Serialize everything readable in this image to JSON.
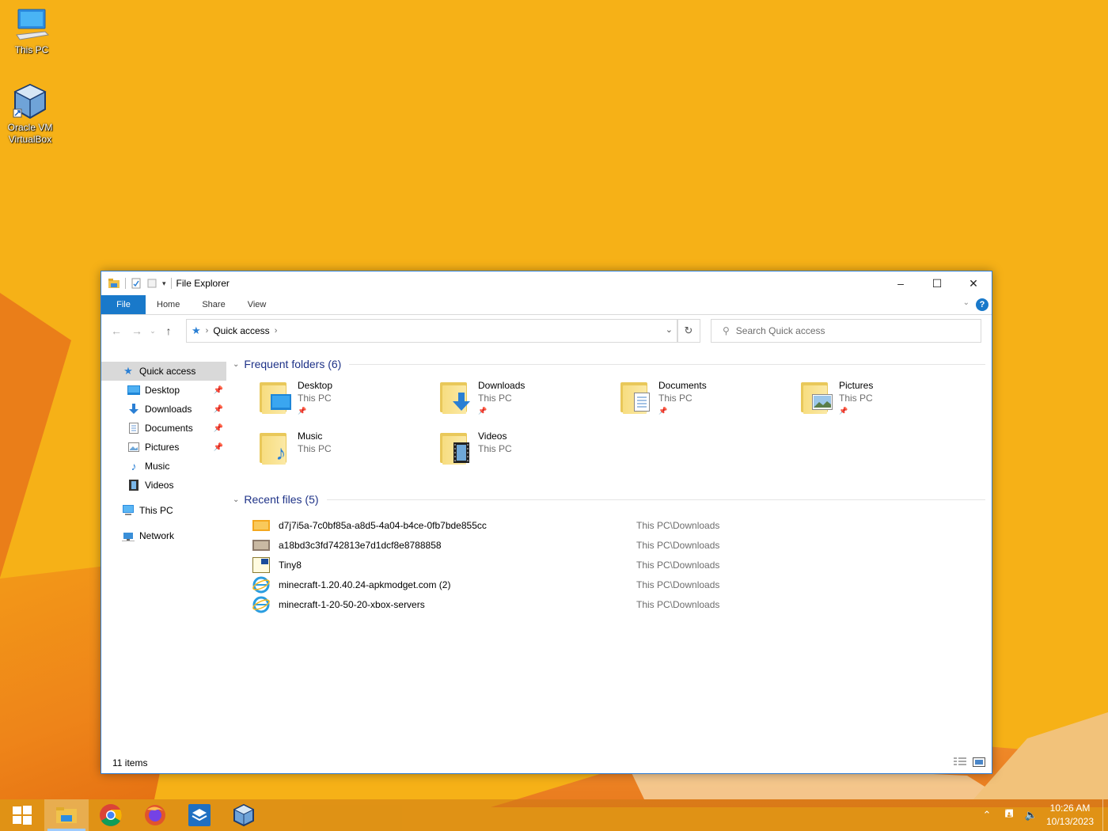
{
  "desktop": {
    "icons": [
      {
        "label": "This PC",
        "icon": "this-pc-icon"
      },
      {
        "label": "Oracle VM VirtualBox",
        "icon": "virtualbox-icon"
      }
    ]
  },
  "window": {
    "title": "File Explorer",
    "ribbon_tabs": [
      "File",
      "Home",
      "Share",
      "View"
    ],
    "help_label": "?",
    "address": {
      "crumb": "Quick access"
    },
    "search": {
      "placeholder": "Search Quick access"
    },
    "nav": {
      "quick_access": "Quick access",
      "items": [
        {
          "label": "Desktop",
          "pinned": true
        },
        {
          "label": "Downloads",
          "pinned": true
        },
        {
          "label": "Documents",
          "pinned": true
        },
        {
          "label": "Pictures",
          "pinned": true
        },
        {
          "label": "Music",
          "pinned": false
        },
        {
          "label": "Videos",
          "pinned": false
        }
      ],
      "this_pc": "This PC",
      "network": "Network"
    },
    "frequent": {
      "header": "Frequent folders (6)",
      "folders": [
        {
          "name": "Desktop",
          "location": "This PC",
          "pinned": true
        },
        {
          "name": "Downloads",
          "location": "This PC",
          "pinned": true
        },
        {
          "name": "Documents",
          "location": "This PC",
          "pinned": true
        },
        {
          "name": "Pictures",
          "location": "This PC",
          "pinned": true
        },
        {
          "name": "Music",
          "location": "This PC",
          "pinned": false
        },
        {
          "name": "Videos",
          "location": "This PC",
          "pinned": false
        }
      ]
    },
    "recent": {
      "header": "Recent files (5)",
      "files": [
        {
          "name": "d7j7i5a-7c0bf85a-a8d5-4a04-b4ce-0fb7bde855cc",
          "location": "This PC\\Downloads",
          "icon": "image-file-icon"
        },
        {
          "name": "a18bd3c3fd742813e7d1dcf8e8788858",
          "location": "This PC\\Downloads",
          "icon": "image-file-icon"
        },
        {
          "name": "Tiny8",
          "location": "This PC\\Downloads",
          "icon": "iso-file-icon"
        },
        {
          "name": "minecraft-1.20.40.24-apkmodget.com (2)",
          "location": "This PC\\Downloads",
          "icon": "ie-html-icon"
        },
        {
          "name": "minecraft-1-20-50-20-xbox-servers",
          "location": "This PC\\Downloads",
          "icon": "ie-html-icon"
        }
      ]
    },
    "status": {
      "count": "11 items"
    }
  },
  "taskbar": {
    "apps": [
      "start",
      "file-explorer",
      "chrome",
      "firefox",
      "sandbox",
      "virtualbox"
    ],
    "clock_time": "10:26 AM",
    "clock_date": "10/13/2023"
  },
  "colors": {
    "accent": "#1979ca",
    "desktop": "#f6b117",
    "group_header": "#1e3287"
  }
}
